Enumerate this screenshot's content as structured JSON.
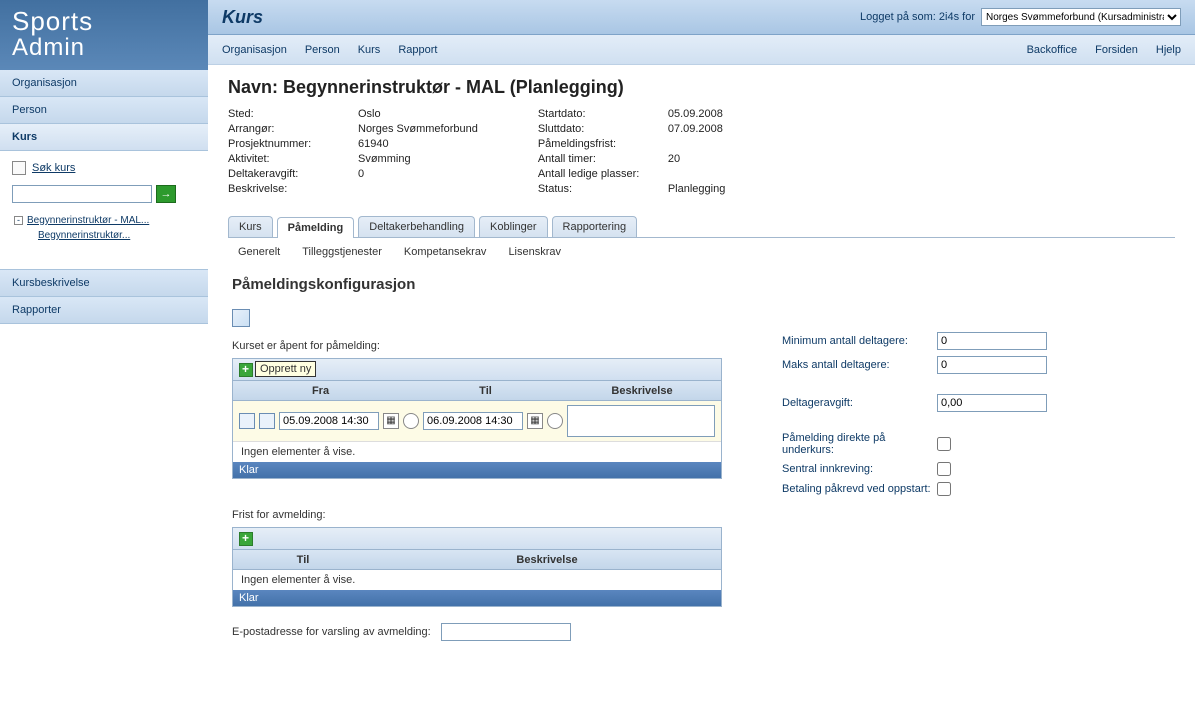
{
  "logo": {
    "l1": "Sports",
    "l2": "Admin"
  },
  "sidebar": {
    "items": [
      "Organisasjon",
      "Person",
      "Kurs"
    ],
    "search_label": "Søk kurs",
    "go_label": "→",
    "tree_root": "Begynnerinstruktør - MAL...",
    "tree_child": "Begynnerinstruktør...",
    "kursbeskrivelse": "Kursbeskrivelse",
    "rapporter": "Rapporter"
  },
  "header": {
    "title": "Kurs",
    "login_text": "Logget på som: 2i4s for",
    "role_selected": "Norges Svømmeforbund (Kursadministrator)"
  },
  "submenu": {
    "left": [
      "Organisasjon",
      "Person",
      "Kurs",
      "Rapport"
    ],
    "right": [
      "Backoffice",
      "Forsiden",
      "Hjelp"
    ]
  },
  "course": {
    "title": "Navn: Begynnerinstruktør - MAL (Planlegging)",
    "left": [
      {
        "lbl": "Sted:",
        "val": "Oslo"
      },
      {
        "lbl": "Arrangør:",
        "val": "Norges Svømmeforbund"
      },
      {
        "lbl": "Prosjektnummer:",
        "val": "61940"
      },
      {
        "lbl": "Aktivitet:",
        "val": "Svømming"
      },
      {
        "lbl": "Deltakeravgift:",
        "val": "0"
      },
      {
        "lbl": "Beskrivelse:",
        "val": ""
      }
    ],
    "right": [
      {
        "lbl": "Startdato:",
        "val": "05.09.2008"
      },
      {
        "lbl": "Sluttdato:",
        "val": "07.09.2008"
      },
      {
        "lbl": "Påmeldingsfrist:",
        "val": ""
      },
      {
        "lbl": "Antall timer:",
        "val": "20"
      },
      {
        "lbl": "Antall ledige plasser:",
        "val": ""
      },
      {
        "lbl": "Status:",
        "val": "Planlegging"
      }
    ]
  },
  "tabs": [
    "Kurs",
    "Påmelding",
    "Deltakerbehandling",
    "Koblinger",
    "Rapportering"
  ],
  "subtabs": [
    "Generelt",
    "Tilleggstjenester",
    "Kompetansekrav",
    "Lisenskrav"
  ],
  "section_title": "Påmeldingskonfigurasjon",
  "open_label": "Kurset er åpent for påmelding:",
  "tooltip_new": "Opprett ny",
  "cols": {
    "fra": "Fra",
    "til": "Til",
    "beskrivelse": "Beskrivelse"
  },
  "date_from": "05.09.2008 14:30",
  "date_to": "06.09.2008 14:30",
  "empty_text": "Ingen elementer å vise.",
  "ready_text": "Klar",
  "deadline_label": "Frist for avmelding:",
  "deadline_cols": {
    "til": "Til",
    "beskrivelse": "Beskrivelse"
  },
  "email_label": "E-postadresse for varsling av avmelding:",
  "right_fields": {
    "min_label": "Minimum antall deltagere:",
    "min_val": "0",
    "max_label": "Maks antall deltagere:",
    "max_val": "0",
    "fee_label": "Deltageravgift:",
    "fee_val": "0,00",
    "sub_label": "Påmelding direkte på underkurs:",
    "central_label": "Sentral innkreving:",
    "pay_label": "Betaling påkrevd ved oppstart:"
  }
}
